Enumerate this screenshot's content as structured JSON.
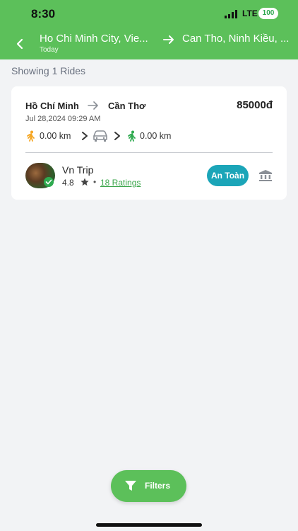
{
  "status_bar": {
    "time": "8:30",
    "network": "LTE",
    "battery": "100"
  },
  "header": {
    "from_city": "Ho Chi Minh City, Vie...",
    "date_label": "Today",
    "to_city": "Can Tho, Ninh Kiều, ..."
  },
  "results": {
    "showing_text": "Showing 1 Rides"
  },
  "ride": {
    "origin": "Hồ Chí Minh",
    "destination": "Cần Thơ",
    "price": "85000đ",
    "datetime": "Jul 28,2024 09:29 AM",
    "walk_to_pickup": "0.00 km",
    "walk_from_dropoff": "0.00 km",
    "driver_name": "Vn Trip",
    "rating": "4.8",
    "separator": "•",
    "ratings_count": "18 Ratings",
    "safety_badge": "An Toàn"
  },
  "footer": {
    "filters_label": "Filters"
  },
  "colors": {
    "brand_green": "#5cc05a",
    "badge_teal": "#1ba5b8",
    "link_green": "#3aa54a",
    "walk_orange": "#f5a623",
    "walk_green": "#2eaa4f"
  },
  "icons": {
    "back": "chevron-left-icon",
    "route": "arrow-right-icon",
    "walk": "walking-person-icon",
    "car": "car-icon",
    "star": "star-icon",
    "bank": "bank-icon",
    "filter": "filter-icon"
  }
}
